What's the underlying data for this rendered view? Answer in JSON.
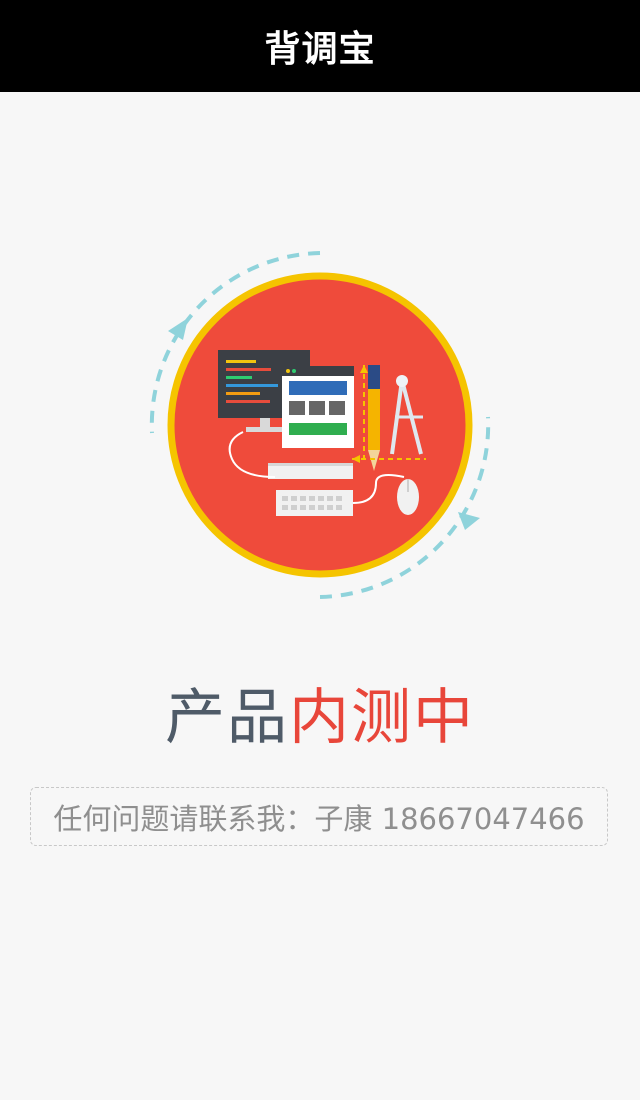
{
  "header": {
    "title": "背调宝"
  },
  "hero": {
    "illustration_icon": "web-development-illustration-icon",
    "colors": {
      "circle_fill": "#ef4b3b",
      "circle_border": "#f5c400",
      "arc_dashes": "#8fd3db"
    }
  },
  "headline": {
    "part1": "产品",
    "part2": "内测中",
    "part1_color": "#4f5b68",
    "part2_color": "#e8463a"
  },
  "contact": {
    "text": "任何问题请联系我：子康 18667047466"
  }
}
